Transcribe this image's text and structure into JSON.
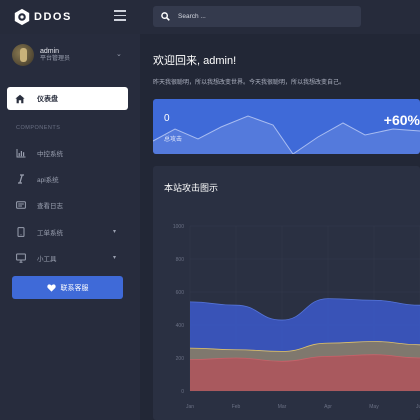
{
  "brand": {
    "name": "DDOS"
  },
  "user": {
    "name": "admin",
    "role": "平台管理员"
  },
  "nav": {
    "dashboard": "仪表盘",
    "section": "COMPONENTS",
    "items": [
      {
        "label": "中控系统",
        "icon": "bar-chart-icon",
        "has_children": false
      },
      {
        "label": "api系统",
        "icon": "italic-icon",
        "has_children": false
      },
      {
        "label": "查看日志",
        "icon": "log-icon",
        "has_children": false
      },
      {
        "label": "工单系统",
        "icon": "tablet-icon",
        "has_children": true
      },
      {
        "label": "小工具",
        "icon": "monitor-icon",
        "has_children": true
      }
    ],
    "support": "联系客服"
  },
  "topbar": {
    "search_placeholder": "Search ..."
  },
  "main": {
    "welcome": "欢迎回来, admin!",
    "subtitle": "昨天我很聪明，所以我想改变世界。今天我很聪明，所以我想改变自己。"
  },
  "stat": {
    "value": "0",
    "label": "总攻击",
    "percent": "+60%"
  },
  "chart_data": {
    "type": "area",
    "title": "本站攻击图示",
    "categories": [
      "Jan",
      "Feb",
      "Mar",
      "Apr",
      "May",
      "Jun"
    ],
    "ylim": [
      0,
      1000
    ],
    "yticks": [
      0,
      200,
      400,
      600,
      800,
      1000
    ],
    "tick_labels": [
      "0",
      "200",
      "400",
      "600",
      "800",
      "1000"
    ],
    "series": [
      {
        "color": "#3b58c4",
        "values": [
          540,
          520,
          430,
          560,
          550,
          520
        ]
      },
      {
        "color": "#8c7f62",
        "values": [
          260,
          250,
          240,
          290,
          300,
          280
        ]
      },
      {
        "color": "#b0545c",
        "values": [
          190,
          200,
          180,
          210,
          220,
          200
        ]
      }
    ],
    "grid": true
  },
  "colors": {
    "accent": "#3f6ad8",
    "sidebar": "#272c3d",
    "background": "#222736"
  }
}
